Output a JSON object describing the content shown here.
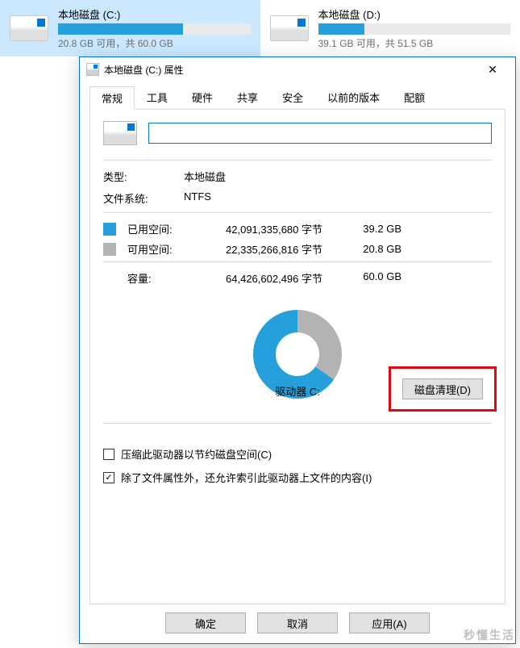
{
  "bg_drives": [
    {
      "name": "本地磁盘 (C:)",
      "free_text": "20.8 GB 可用，共 60.0 GB",
      "fill_pct": 65
    },
    {
      "name": "本地磁盘 (D:)",
      "free_text": "39.1 GB 可用，共 51.5 GB",
      "fill_pct": 24
    }
  ],
  "dialog": {
    "title": "本地磁盘 (C:) 属性",
    "tabs": [
      "常规",
      "工具",
      "硬件",
      "共享",
      "安全",
      "以前的版本",
      "配额"
    ],
    "active_tab": 0,
    "name_value": "",
    "type_label": "类型:",
    "type_value": "本地磁盘",
    "fs_label": "文件系统:",
    "fs_value": "NTFS",
    "used_label": "已用空间:",
    "used_bytes": "42,091,335,680 字节",
    "used_gb": "39.2 GB",
    "free_label": "可用空间:",
    "free_bytes": "22,335,266,816 字节",
    "free_gb": "20.8 GB",
    "cap_label": "容量:",
    "cap_bytes": "64,426,602,496 字节",
    "cap_gb": "60.0 GB",
    "drive_label": "驱动器 C:",
    "cleanup_btn": "磁盘清理(D)",
    "cb_compress": "压缩此驱动器以节约磁盘空间(C)",
    "cb_index": "除了文件属性外，还允许索引此驱动器上文件的内容(I)",
    "ok": "确定",
    "cancel": "取消",
    "apply": "应用(A)"
  },
  "watermark": {
    "big": "秒懂生活"
  },
  "chart_data": {
    "type": "pie",
    "title": "驱动器 C:",
    "series": [
      {
        "name": "已用空间",
        "value": 39.2,
        "color": "#26a0da"
      },
      {
        "name": "可用空间",
        "value": 20.8,
        "color": "#b3b3b3"
      }
    ],
    "unit": "GB",
    "total": 60.0
  }
}
